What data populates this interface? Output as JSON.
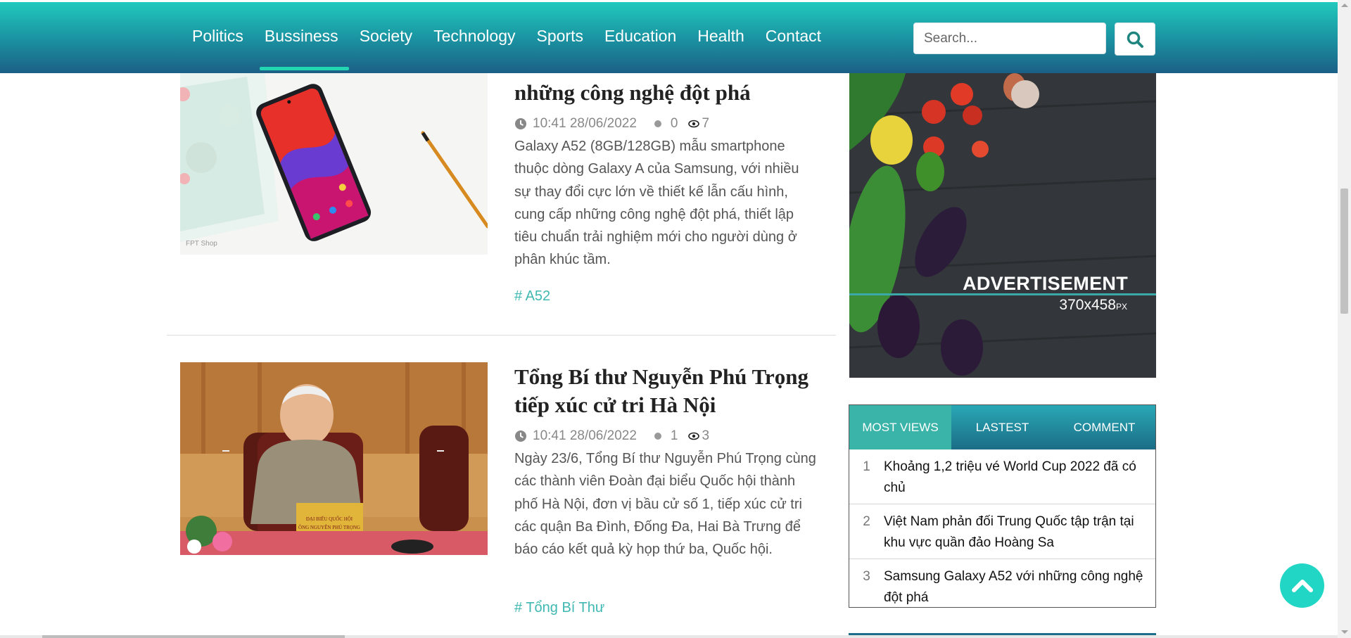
{
  "nav": {
    "items": [
      {
        "label": "Politics",
        "active": false
      },
      {
        "label": "Bussiness",
        "active": true
      },
      {
        "label": "Society",
        "active": false
      },
      {
        "label": "Technology",
        "active": false
      },
      {
        "label": "Sports",
        "active": false
      },
      {
        "label": "Education",
        "active": false
      },
      {
        "label": "Health",
        "active": false
      },
      {
        "label": "Contact",
        "active": false
      }
    ],
    "search_placeholder": "Search..."
  },
  "articles": [
    {
      "title": "những công nghệ đột phá",
      "time": "10:41 28/06/2022",
      "comments": "0",
      "views": "7",
      "excerpt": "Galaxy A52 (8GB/128GB) mẫu smartphone thuộc dòng Galaxy A của Samsung, với nhiều sự thay đổi cực lớn về thiết kế lẫn cấu hình, cung cấp những công nghệ đột phá, thiết lập tiêu chuẩn trải nghiệm mới cho người dùng ở phân khúc tầm.",
      "tag": "# A52"
    },
    {
      "title": "Tổng Bí thư Nguyễn Phú Trọng tiếp xúc cử tri Hà Nội",
      "time": "10:41 28/06/2022",
      "comments": "1",
      "views": "3",
      "excerpt": "Ngày 23/6, Tổng Bí thư Nguyễn Phú Trọng cùng các thành viên Đoàn đại biểu Quốc hội thành phố Hà Nội, đơn vị bầu cử số 1, tiếp xúc cử tri các quận Ba Đình, Đống Đa, Hai Bà Trưng để báo cáo kết quả kỳ họp thứ ba, Quốc hội.",
      "tag": "# Tổng Bí Thư"
    }
  ],
  "sidebar": {
    "ad": {
      "label": "ADVERTISEMENT",
      "size": "370x458",
      "unit": "PX"
    },
    "tabs": [
      {
        "label": "MOST VIEWS",
        "active": true
      },
      {
        "label": "LASTEST",
        "active": false
      },
      {
        "label": "COMMENT",
        "active": false
      }
    ],
    "popular": [
      {
        "num": "1",
        "title": "Khoảng 1,2 triệu vé World Cup 2022 đã có chủ"
      },
      {
        "num": "2",
        "title": "Việt Nam phản đối Trung Quốc tập trận tại khu vực quần đảo Hoàng Sa"
      },
      {
        "num": "3",
        "title": "Samsung Galaxy A52 với những công nghệ đột phá"
      }
    ]
  },
  "colors": {
    "accent": "#3fb8b2",
    "nav_top": "#21c9bd",
    "nav_bottom": "#1b5f86",
    "back_to_top": "#22d6c5"
  }
}
